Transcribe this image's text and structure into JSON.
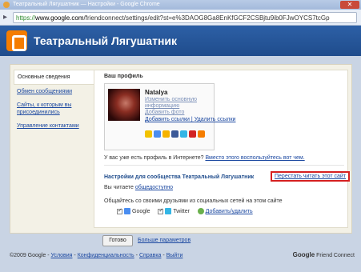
{
  "window": {
    "title": "Театральный Лягушатник — Настройки - Google Chrome",
    "close_glyph": "✕"
  },
  "urlbar": {
    "scheme": "https://",
    "host": "www.google.com",
    "path": "/friendconnect/settings/edit?st=e%3DAOG8Ga8EnKfGCF2CSBjtu9ib0FJwOYCS7tcGp"
  },
  "header": {
    "site_title": "Театральный Лягушатник",
    "logo_icon": "blogger-icon"
  },
  "sidebar": {
    "items": [
      {
        "label": "Основные сведения"
      },
      {
        "label": "Обмен сообщениями"
      },
      {
        "label": "Сайты, к которым вы присоединились"
      },
      {
        "label": "Управление контактами"
      }
    ]
  },
  "profile": {
    "section_title": "Ваш профиль",
    "name": "Natalya",
    "edit_info_link": "Изменить основную информацию",
    "add_photo_link": "Добавить фото",
    "add_links_link": "Добавить ссылки",
    "remove_links_link": "Удалить ссылки",
    "social_icons": [
      "star-icon",
      "google-icon",
      "aim-icon",
      "facebook-icon",
      "twitter-icon",
      "youtube-icon",
      "blogger-icon"
    ],
    "question": "У вас уже есть профиль в Интернете?",
    "use_it_link": "Вместо этого воспользуйтесь вот чем."
  },
  "community": {
    "settings_title": "Настройки для сообщества Театральный Лягушатник",
    "stop_reading_link": "Перестать читать этот сайт",
    "reading_text": "Вы читаете",
    "reading_mode_link": "общедоступно",
    "share_text": "Общайтесь со своими друзьями из социальных сетей на этом сайте",
    "networks": [
      {
        "label": "Google"
      },
      {
        "label": "Twitter"
      }
    ],
    "add_remove_link": "Добавить/удалить"
  },
  "footer": {
    "done_button": "Готово",
    "more_settings_link": "Больше параметров",
    "copyright": "©2009 Google -",
    "links": [
      "Условия",
      "Конфиденциальность",
      "Справка",
      "Выйти"
    ],
    "separator": "-",
    "brand_google": "Google",
    "brand_product": "Friend Connect"
  },
  "colors": {
    "header": "#1f4c8c",
    "link": "#1a47a0",
    "highlight_border": "#d62020",
    "logo": "#f57d00"
  }
}
